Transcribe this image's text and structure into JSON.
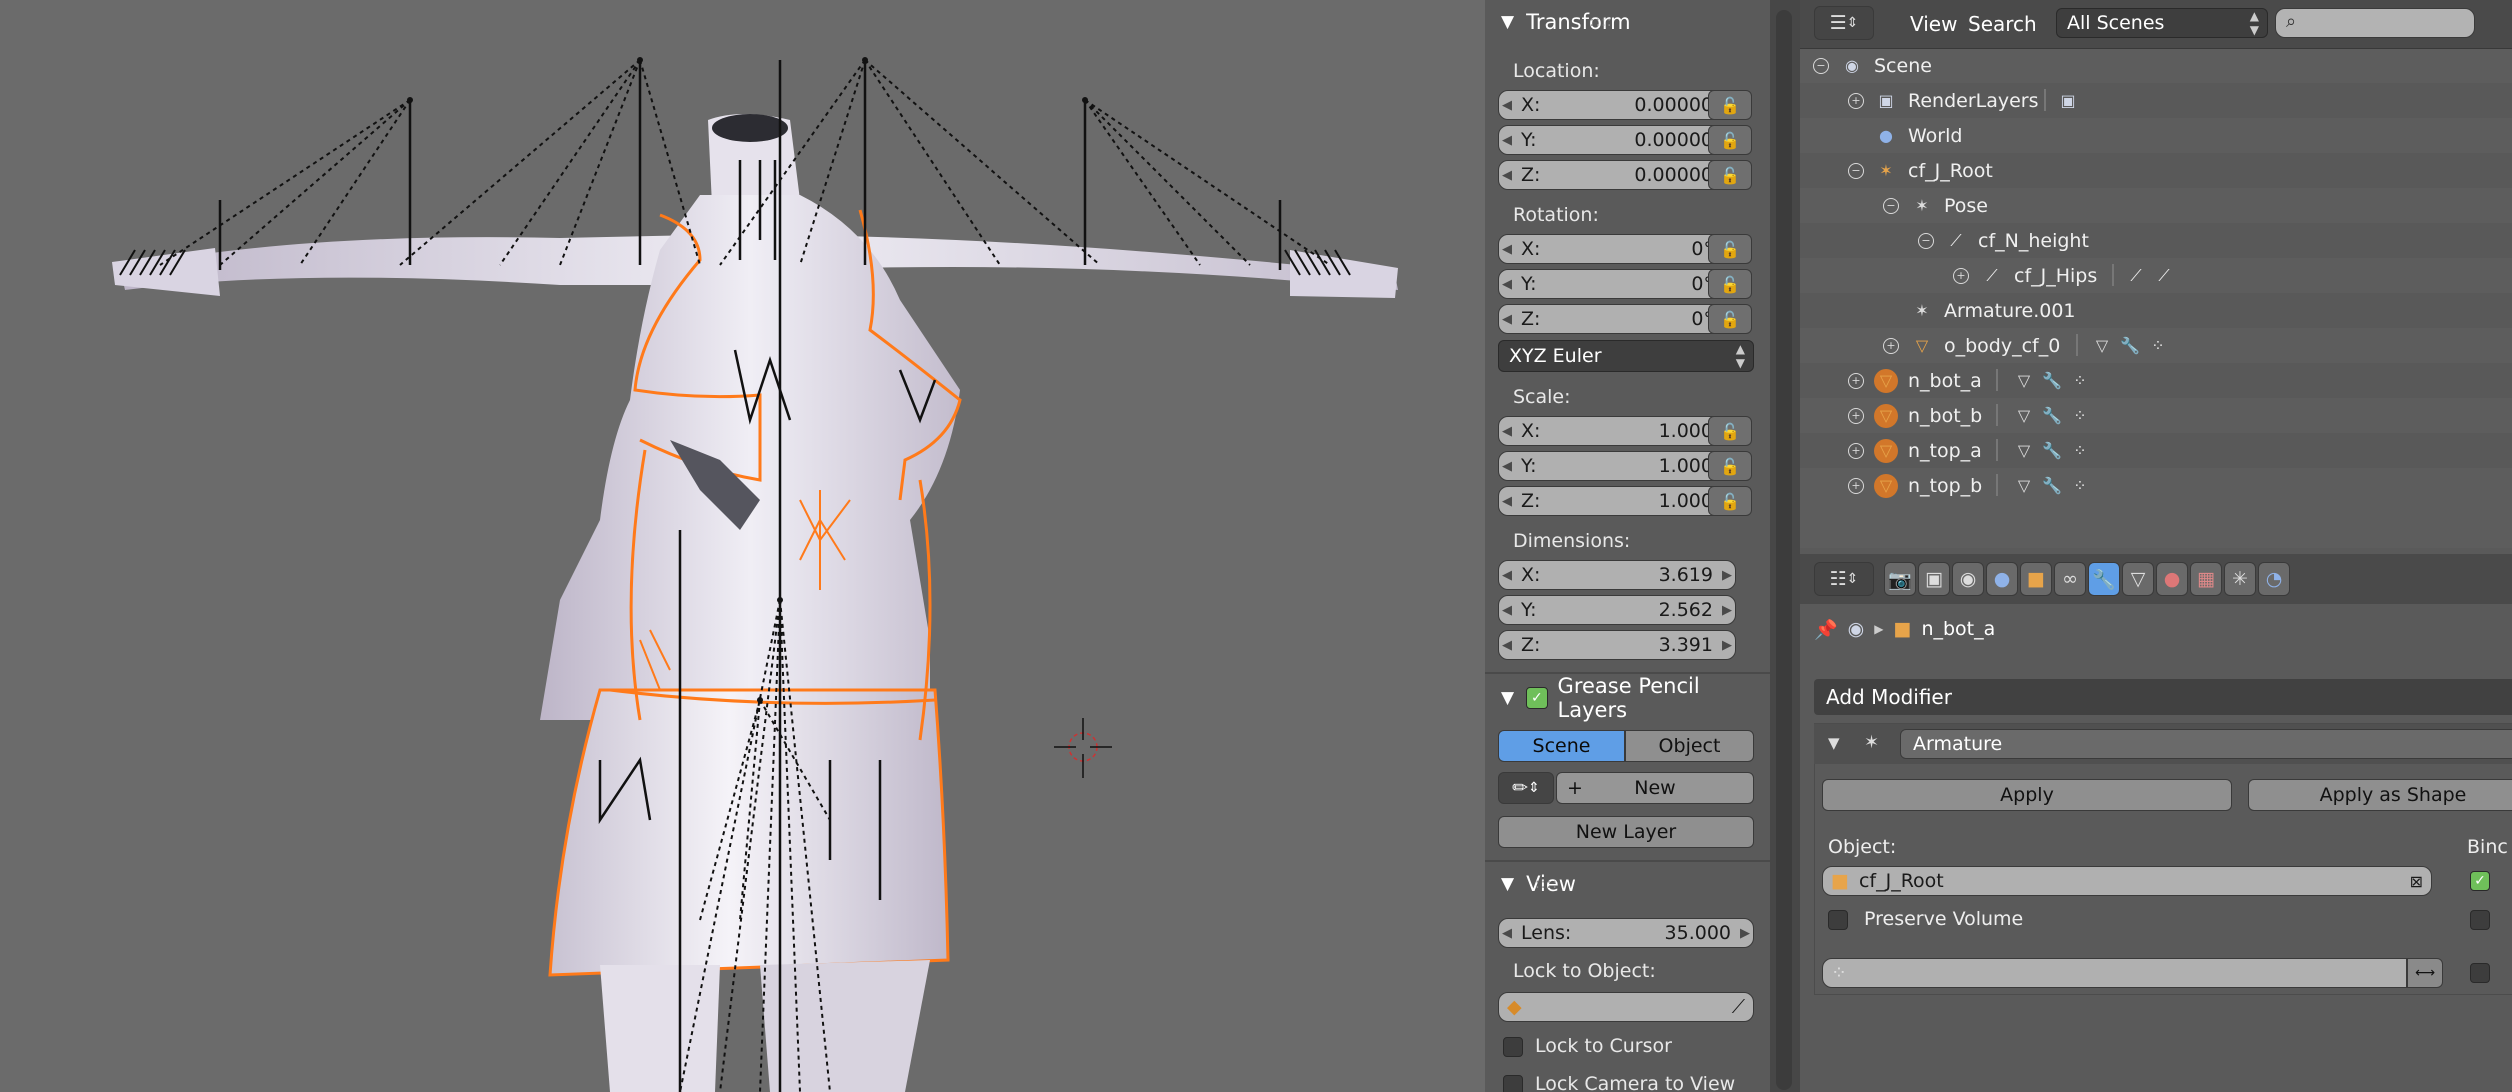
{
  "transform_panel": {
    "header": "Transform",
    "location_label": "Location:",
    "location": [
      {
        "axis": "X:",
        "value": "0.00000"
      },
      {
        "axis": "Y:",
        "value": "0.00000"
      },
      {
        "axis": "Z:",
        "value": "0.00000"
      }
    ],
    "rotation_label": "Rotation:",
    "rotation": [
      {
        "axis": "X:",
        "value": "0°"
      },
      {
        "axis": "Y:",
        "value": "0°"
      },
      {
        "axis": "Z:",
        "value": "0°"
      }
    ],
    "rotation_mode": "XYZ Euler",
    "scale_label": "Scale:",
    "scale": [
      {
        "axis": "X:",
        "value": "1.000"
      },
      {
        "axis": "Y:",
        "value": "1.000"
      },
      {
        "axis": "Z:",
        "value": "1.000"
      }
    ],
    "dimensions_label": "Dimensions:",
    "dimensions": [
      {
        "axis": "X:",
        "value": "3.619"
      },
      {
        "axis": "Y:",
        "value": "2.562"
      },
      {
        "axis": "Z:",
        "value": "3.391"
      }
    ]
  },
  "grease_pencil": {
    "header": "Grease Pencil Layers",
    "tab_scene": "Scene",
    "tab_object": "Object",
    "new_label": "New",
    "new_layer_label": "New Layer"
  },
  "view_panel": {
    "header": "View",
    "lens_label": "Lens:",
    "lens_value": "35.000",
    "lock_to_object_label": "Lock to Object:",
    "lock_to_cursor": "Lock to Cursor",
    "lock_camera_to_view": "Lock Camera to View"
  },
  "outliner": {
    "menu_view": "View",
    "menu_search": "Search",
    "scene_filter": "All Scenes",
    "search_placeholder": "",
    "rows": [
      {
        "label": "Scene",
        "depth": 0,
        "icon": "scene-icon",
        "expander": "minus"
      },
      {
        "label": "RenderLayers",
        "depth": 1,
        "icon": "render-layers-icon",
        "expander": "plus"
      },
      {
        "label": "World",
        "depth": 1,
        "icon": "world-icon",
        "expander": ""
      },
      {
        "label": "cf_J_Root",
        "depth": 1,
        "icon": "armature-icon",
        "expander": "minus"
      },
      {
        "label": "Pose",
        "depth": 2,
        "icon": "pose-icon",
        "expander": "minus"
      },
      {
        "label": "cf_N_height",
        "depth": 3,
        "icon": "bone-icon",
        "expander": "minus"
      },
      {
        "label": "cf_J_Hips",
        "depth": 4,
        "icon": "bone-icon",
        "expander": "plus"
      },
      {
        "label": "Armature.001",
        "depth": 3,
        "icon": "armature-data-icon",
        "expander": ""
      },
      {
        "label": "o_body_cf_0",
        "depth": 2,
        "icon": "mesh-object-icon",
        "expander": "plus"
      },
      {
        "label": "n_bot_a",
        "depth": 1,
        "icon": "mesh-object-icon",
        "expander": "plus"
      },
      {
        "label": "n_bot_b",
        "depth": 1,
        "icon": "mesh-object-icon",
        "expander": "plus"
      },
      {
        "label": "n_top_a",
        "depth": 1,
        "icon": "mesh-object-icon",
        "expander": "plus"
      },
      {
        "label": "n_top_b",
        "depth": 1,
        "icon": "mesh-object-icon",
        "expander": "plus"
      }
    ]
  },
  "properties": {
    "breadcrumb_object": "n_bot_a",
    "add_modifier_label": "Add Modifier",
    "modifier_name": "Armature",
    "apply_label": "Apply",
    "apply_as_shape_label": "Apply as Shape",
    "object_label": "Object:",
    "object_value": "cf_J_Root",
    "bind_label": "Binc",
    "preserve_volume_label": "Preserve Volume",
    "vertex_group_value": ""
  },
  "colors": {
    "viewport_bg": "#6b6b6b",
    "selection_outline": "#ff7a1a",
    "active_tab": "#5f9ee6",
    "check_on": "#6fbf5a"
  }
}
